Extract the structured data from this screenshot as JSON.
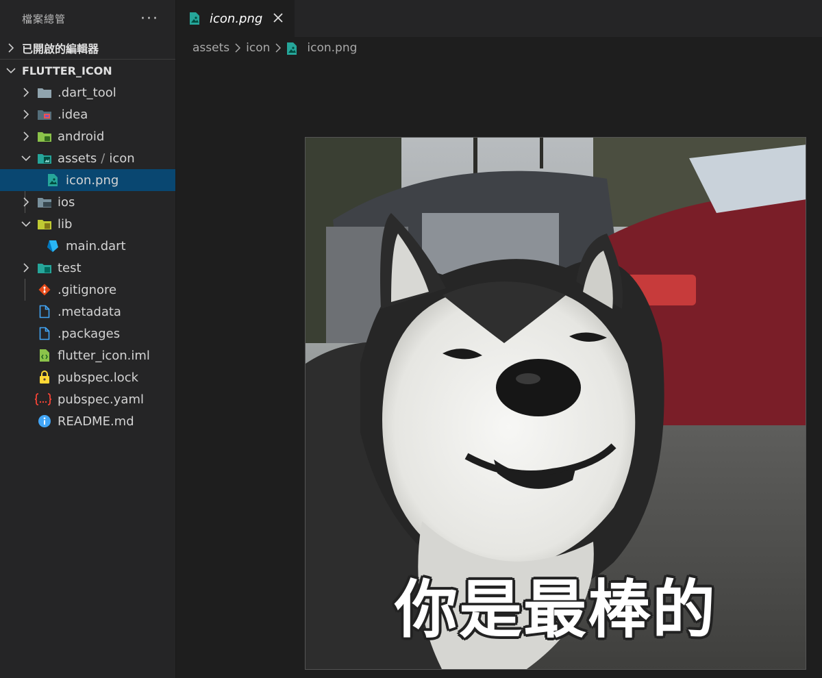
{
  "sidebar": {
    "title": "檔案總管",
    "more_label": "···",
    "open_editors_label": "已開啟的編輯器",
    "project_label": "FLUTTER_ICON",
    "items": [
      {
        "label": ".dart_tool",
        "type": "folder",
        "icon": "folder-icon"
      },
      {
        "label": ".idea",
        "type": "folder",
        "icon": "idea-folder-icon"
      },
      {
        "label": "android",
        "type": "folder",
        "icon": "android-folder-icon"
      },
      {
        "label": "assets",
        "sublabel": "icon",
        "separator": "/",
        "type": "folder-open",
        "icon": "assets-folder-icon"
      },
      {
        "label": "icon.png",
        "type": "file",
        "icon": "image-file-icon",
        "selected": true
      },
      {
        "label": "ios",
        "type": "folder",
        "icon": "ios-folder-icon"
      },
      {
        "label": "lib",
        "type": "folder-open",
        "icon": "lib-folder-icon"
      },
      {
        "label": "main.dart",
        "type": "file",
        "icon": "dart-file-icon"
      },
      {
        "label": "test",
        "type": "folder",
        "icon": "test-folder-icon"
      },
      {
        "label": ".gitignore",
        "type": "file",
        "icon": "git-file-icon"
      },
      {
        "label": ".metadata",
        "type": "file",
        "icon": "file-icon"
      },
      {
        "label": ".packages",
        "type": "file",
        "icon": "file-icon"
      },
      {
        "label": "flutter_icon.iml",
        "type": "file",
        "icon": "xml-file-icon"
      },
      {
        "label": "pubspec.lock",
        "type": "file",
        "icon": "lock-file-icon"
      },
      {
        "label": "pubspec.yaml",
        "type": "file",
        "icon": "yaml-file-icon"
      },
      {
        "label": "README.md",
        "type": "file",
        "icon": "info-file-icon"
      }
    ]
  },
  "editor": {
    "tab_label": "icon.png",
    "breadcrumb": [
      "assets",
      "icon",
      "icon.png"
    ],
    "image_caption": "你是最棒的"
  },
  "colors": {
    "sidebar_bg": "#252526",
    "editor_bg": "#1e1e1e",
    "selection": "#094771",
    "image_icon": "#26a69a"
  }
}
